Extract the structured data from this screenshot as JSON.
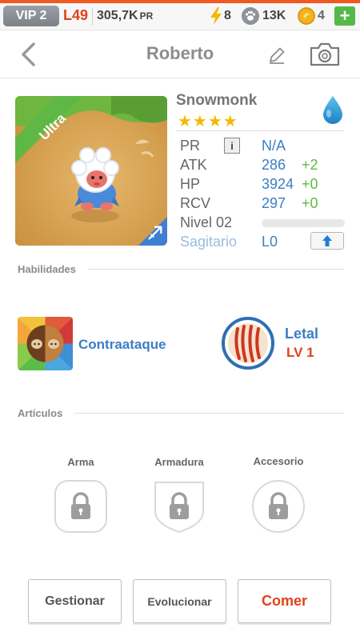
{
  "status_bar": {
    "vip": "VIP 2",
    "level": "L49",
    "power_value": "305,7K",
    "power_unit": "PR",
    "energy": "8",
    "paws": "13K",
    "gems": "4",
    "add_label": "+",
    "accent_color": "#f05a22"
  },
  "header": {
    "title": "Roberto",
    "back_icon": "chevron-left-icon",
    "edit_icon": "pencil-icon",
    "camera_icon": "camera-icon"
  },
  "pet": {
    "rarity": "Ultra",
    "species": "Snowmonk",
    "stars": "★★★★",
    "star_count": 4,
    "element_icon": "water-drop-icon",
    "class_icon": "archer-arrow-icon",
    "stats": {
      "pr": {
        "label": "PR",
        "value": "N/A"
      },
      "atk": {
        "label": "ATK",
        "value": "286",
        "bonus": "+2"
      },
      "hp": {
        "label": "HP",
        "value": "3924",
        "bonus": "+0"
      },
      "rcv": {
        "label": "RCV",
        "value": "297",
        "bonus": "+0"
      },
      "level": {
        "label": "Nivel 02",
        "progress": 0
      },
      "sign": {
        "label": "Sagitario",
        "value": "L0"
      }
    }
  },
  "skills": {
    "section_label": "Habilidades",
    "active": {
      "name": "Contraataque",
      "icon": "counterattack-icon"
    },
    "passive": {
      "name": "Letal",
      "level": "LV 1",
      "icon": "claw-marks-icon"
    }
  },
  "items": {
    "section_label": "Artículos",
    "slots": [
      {
        "label": "Arma",
        "icon": "lock-icon"
      },
      {
        "label": "Armadura",
        "icon": "lock-icon"
      },
      {
        "label": "Accesorio",
        "icon": "lock-icon"
      }
    ]
  },
  "actions": {
    "manage": "Gestionar",
    "evolve": "Evolucionar",
    "eat": "Comer",
    "eat_color": "#e0421b"
  }
}
